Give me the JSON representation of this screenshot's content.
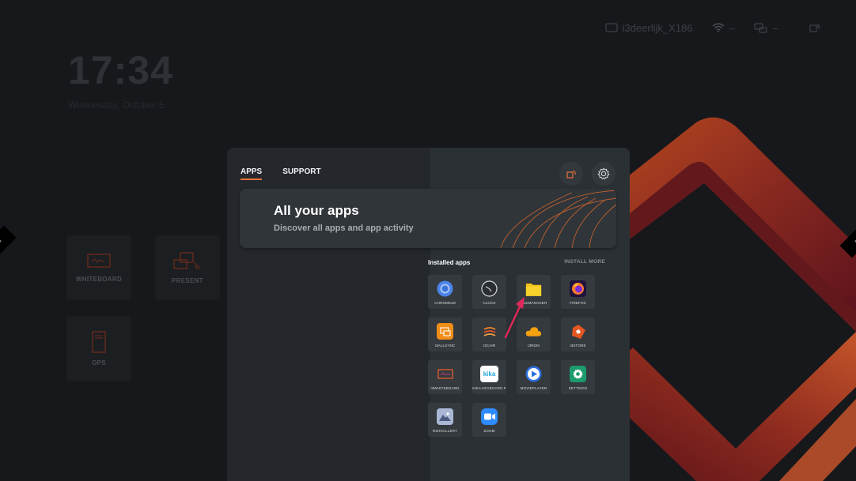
{
  "status_bar": {
    "device_name": "i3deerlijk_X186",
    "wifi_value": "–",
    "network_value": "–"
  },
  "clock": {
    "time": "17:34",
    "date": "Wednesday, October 5"
  },
  "home_tiles": [
    {
      "label": "WHITEBOARD",
      "icon": "whiteboard-icon"
    },
    {
      "label": "PRESENT",
      "icon": "present-icon"
    },
    {
      "label": "OPS",
      "icon": "ops-icon"
    }
  ],
  "panel": {
    "tabs": [
      {
        "label": "APPS",
        "active": true
      },
      {
        "label": "SUPPORT",
        "active": false
      }
    ],
    "hero": {
      "title": "All your apps",
      "subtitle": "Discover all apps and app activity"
    },
    "installed_label": "Installed apps",
    "install_more_label": "INSTALL MORE",
    "apps": [
      {
        "label": "CHROMIUM",
        "icon": "chromium-icon"
      },
      {
        "label": "CLOCK",
        "icon": "clock-icon"
      },
      {
        "label": "FILEMANAGER",
        "icon": "folder-icon"
      },
      {
        "label": "FIREFOX",
        "icon": "firefox-icon"
      },
      {
        "label": "I3ALLSYNC",
        "icon": "allsync-icon"
      },
      {
        "label": "I3CAIR",
        "icon": "cair-icon"
      },
      {
        "label": "I3RDM",
        "icon": "cloud-icon"
      },
      {
        "label": "I3STORE",
        "icon": "store-icon"
      },
      {
        "label": "I3WHITEBOARD",
        "icon": "whiteboard-app-icon"
      },
      {
        "label": "KIKA KEYBOARD F",
        "icon": "kika-icon",
        "icon_text": "kika"
      },
      {
        "label": "MOVIEPLAYER",
        "icon": "play-icon"
      },
      {
        "label": "SETTINGS",
        "icon": "settings-gear-icon"
      },
      {
        "label": "R3HGALLERY",
        "icon": "gallery-icon"
      },
      {
        "label": "ZOOM",
        "icon": "zoom-icon"
      }
    ]
  },
  "colors": {
    "accent": "#e8713a",
    "background": "#16181b",
    "panel": "#24282c",
    "deco_red": "#6a1620",
    "deco_orange": "#b8491f"
  }
}
